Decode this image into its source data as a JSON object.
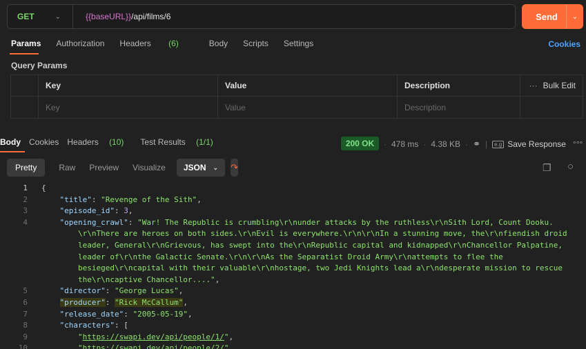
{
  "request": {
    "method": "GET",
    "url_var": "{{baseURL}}",
    "url_path": "/api/films/6",
    "send_label": "Send"
  },
  "tabs": {
    "params": "Params",
    "authorization": "Authorization",
    "headers": "Headers",
    "headers_count": "(6)",
    "body": "Body",
    "scripts": "Scripts",
    "settings": "Settings",
    "cookies": "Cookies"
  },
  "query_params": {
    "title": "Query Params",
    "headers": [
      "Key",
      "Value",
      "Description"
    ],
    "bulk_edit": "Bulk Edit",
    "placeholders": [
      "Key",
      "Value",
      "Description"
    ]
  },
  "response": {
    "tabs": {
      "body": "Body",
      "cookies": "Cookies",
      "headers": "Headers",
      "headers_count": "(10)",
      "test_results": "Test Results",
      "test_results_count": "(1/1)"
    },
    "status": "200 OK",
    "time": "478 ms",
    "size": "4.38 KB",
    "save_response": "Save Response",
    "format": {
      "pretty": "Pretty",
      "raw": "Raw",
      "preview": "Preview",
      "visualize": "Visualize",
      "json": "JSON"
    }
  },
  "code": {
    "lines": [
      {
        "n": "1",
        "parts": [
          {
            "t": "{",
            "c": "p"
          }
        ]
      },
      {
        "n": "2",
        "parts": [
          {
            "t": "    ",
            "c": "p"
          },
          {
            "t": "\"title\"",
            "c": "key"
          },
          {
            "t": ": ",
            "c": "p"
          },
          {
            "t": "\"Revenge of the Sith\"",
            "c": "s"
          },
          {
            "t": ",",
            "c": "p"
          }
        ]
      },
      {
        "n": "3",
        "parts": [
          {
            "t": "    ",
            "c": "p"
          },
          {
            "t": "\"episode_id\"",
            "c": "key"
          },
          {
            "t": ": ",
            "c": "p"
          },
          {
            "t": "3",
            "c": "n"
          },
          {
            "t": ",",
            "c": "p"
          }
        ]
      },
      {
        "n": "4",
        "parts": [
          {
            "t": "    ",
            "c": "p"
          },
          {
            "t": "\"opening_crawl\"",
            "c": "key"
          },
          {
            "t": ": ",
            "c": "p"
          },
          {
            "t": "\"War! The Republic is crumbling\\r\\nunder attacks by the ruthless\\r\\nSith Lord, Count Dooku.",
            "c": "s"
          }
        ]
      },
      {
        "n": "",
        "parts": [
          {
            "t": "        \\r\\nThere are heroes on both sides.\\r\\nEvil is everywhere.\\r\\n\\r\\nIn a stunning move, the\\r\\nfiendish droid",
            "c": "s"
          }
        ]
      },
      {
        "n": "",
        "parts": [
          {
            "t": "        leader, General\\r\\nGrievous, has swept into the\\r\\nRepublic capital and kidnapped\\r\\nChancellor Palpatine,",
            "c": "s"
          }
        ]
      },
      {
        "n": "",
        "parts": [
          {
            "t": "        leader of\\r\\nthe Galactic Senate.\\r\\n\\r\\nAs the Separatist Droid Army\\r\\nattempts to flee the",
            "c": "s"
          }
        ]
      },
      {
        "n": "",
        "parts": [
          {
            "t": "        besieged\\r\\ncapital with their valuable\\r\\nhostage, two Jedi Knights lead a\\r\\ndesperate mission to rescue",
            "c": "s"
          }
        ]
      },
      {
        "n": "",
        "parts": [
          {
            "t": "        the\\r\\ncaptive Chancellor....\"",
            "c": "s"
          },
          {
            "t": ",",
            "c": "p"
          }
        ]
      },
      {
        "n": "5",
        "parts": [
          {
            "t": "    ",
            "c": "p"
          },
          {
            "t": "\"director\"",
            "c": "key"
          },
          {
            "t": ": ",
            "c": "p"
          },
          {
            "t": "\"George Lucas\"",
            "c": "s"
          },
          {
            "t": ",",
            "c": "p"
          }
        ]
      },
      {
        "n": "6",
        "parts": [
          {
            "t": "    ",
            "c": "p"
          },
          {
            "t": "\"producer\"",
            "c": "key hl"
          },
          {
            "t": ": ",
            "c": "p"
          },
          {
            "t": "\"Rick McCallum\"",
            "c": "s hl"
          },
          {
            "t": ",",
            "c": "p"
          }
        ]
      },
      {
        "n": "7",
        "parts": [
          {
            "t": "    ",
            "c": "p"
          },
          {
            "t": "\"release_date\"",
            "c": "key"
          },
          {
            "t": ": ",
            "c": "p"
          },
          {
            "t": "\"2005-05-19\"",
            "c": "s"
          },
          {
            "t": ",",
            "c": "p"
          }
        ]
      },
      {
        "n": "8",
        "parts": [
          {
            "t": "    ",
            "c": "p"
          },
          {
            "t": "\"characters\"",
            "c": "key"
          },
          {
            "t": ": [",
            "c": "p"
          }
        ]
      },
      {
        "n": "9",
        "parts": [
          {
            "t": "        \"",
            "c": "s"
          },
          {
            "t": "https://swapi.dev/api/people/1/",
            "c": "link"
          },
          {
            "t": "\"",
            "c": "s"
          },
          {
            "t": ",",
            "c": "p"
          }
        ]
      },
      {
        "n": "10",
        "parts": [
          {
            "t": "        \"",
            "c": "s"
          },
          {
            "t": "https://swapi.dev/api/people/2/",
            "c": "link"
          },
          {
            "t": "\"",
            "c": "s"
          },
          {
            "t": ",",
            "c": "p"
          }
        ]
      }
    ]
  }
}
